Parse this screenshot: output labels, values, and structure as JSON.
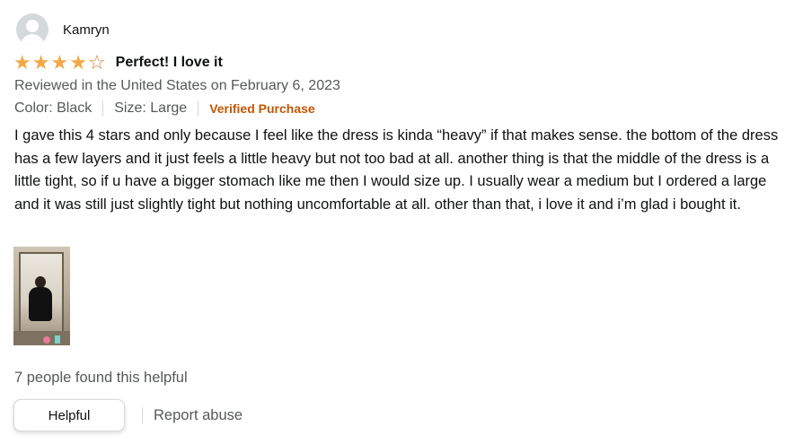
{
  "reviewer": {
    "name": "Kamryn",
    "avatar_icon": "default-avatar-icon"
  },
  "rating": {
    "value": 4,
    "max": 5,
    "star_color": "#f3a847"
  },
  "review": {
    "title": "Perfect! I love it",
    "date_line": "Reviewed in the United States on February 6, 2023",
    "color": "Color: Black",
    "size": "Size: Large",
    "verified": "Verified Purchase",
    "body": "I gave this 4 stars and only because I feel like the dress is kinda “heavy” if that makes sense. the bottom of the dress has a few layers and it just feels a little heavy but not too bad at all. another thing is that the middle of the dress is a little tight, so if u have a bigger stomach like me then I would size up. I usually wear a medium but I ordered a large and it was still just slightly tight but nothing uncomfortable at all. other than that, i love it and i’m glad i bought it."
  },
  "helpful_count_text": "7 people found this helpful",
  "actions": {
    "helpful_label": "Helpful",
    "report_label": "Report abuse"
  },
  "colors": {
    "verified": "#c45500",
    "secondary_text": "#565959",
    "primary_text": "#0f1111"
  }
}
